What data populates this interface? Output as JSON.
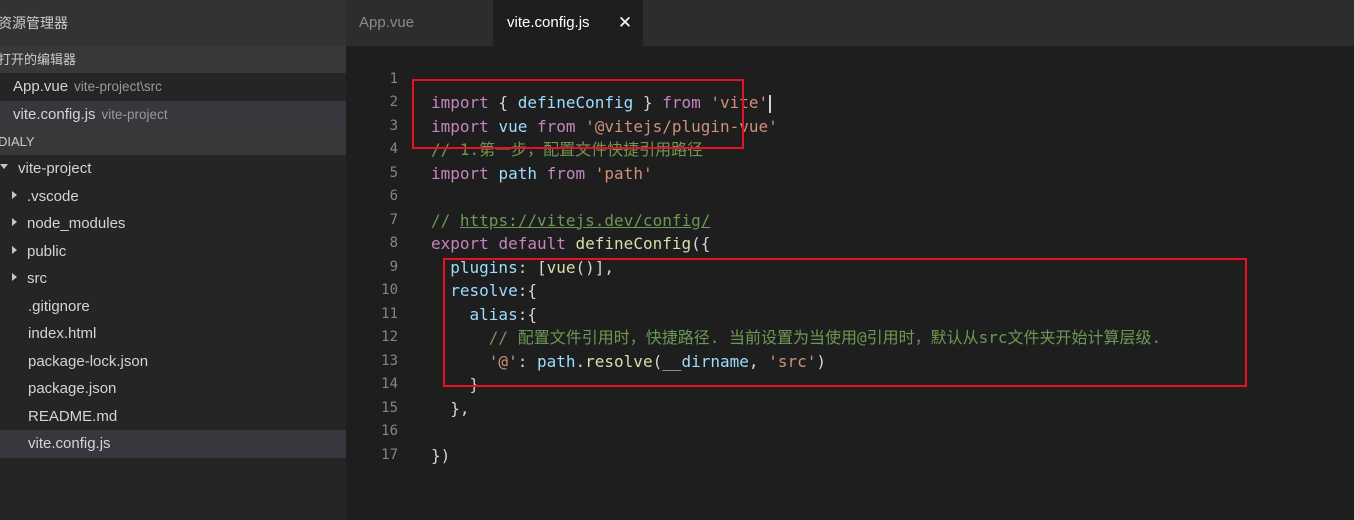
{
  "sidebar": {
    "title": "资源管理器",
    "open_editors_title": "打开的编辑器",
    "open_editors": [
      {
        "name": "App.vue",
        "path": "vite-project\\src"
      },
      {
        "name": "vite.config.js",
        "path": "vite-project"
      }
    ],
    "workspace_title": "DIALY",
    "tree": {
      "root": "vite-project",
      "folders": [
        ".vscode",
        "node_modules",
        "public",
        "src"
      ],
      "files": [
        ".gitignore",
        "index.html",
        "package-lock.json",
        "package.json",
        "README.md",
        "vite.config.js"
      ]
    }
  },
  "tabs": [
    {
      "label": "App.vue",
      "active": false
    },
    {
      "label": "vite.config.js",
      "active": true,
      "close_glyph": "✕"
    }
  ],
  "editor": {
    "line_numbers": [
      "1",
      "2",
      "3",
      "4",
      "5",
      "6",
      "7",
      "8",
      "9",
      "10",
      "11",
      "12",
      "13",
      "14",
      "15",
      "16",
      "17"
    ],
    "tokens": {
      "import": "import",
      "from": "from",
      "export": "export",
      "default": "default",
      "defineConfig": "defineConfig",
      "vue": "vue",
      "path": "path",
      "plugins": "plugins",
      "resolve": "resolve",
      "alias": "alias",
      "resolve_fn": "resolve",
      "dirname": "__dirname",
      "str_vite": "'vite'",
      "str_plugin_vue": "'@vitejs/plugin-vue'",
      "str_path": "'path'",
      "str_at": "'@'",
      "str_src": "'src'"
    },
    "comments": {
      "line3": "// 1.第一步，配置文件快捷引用路径",
      "line6_prefix": "// ",
      "line6_url": "https://vitejs.dev/config/",
      "line11": "// 配置文件引用时，快捷路径. 当前设置为当使用@引用时，默认从src文件夹开始计算层级."
    }
  },
  "colors": {
    "editor_bg": "#1e1e1e",
    "sidebar_bg": "#252526",
    "keyword": "#c586c0",
    "keyword_blue": "#569cd6",
    "function": "#dcdcaa",
    "string": "#ce9178",
    "variable": "#9cdcfe",
    "comment": "#6a9955",
    "highlight_box": "#e81123"
  }
}
